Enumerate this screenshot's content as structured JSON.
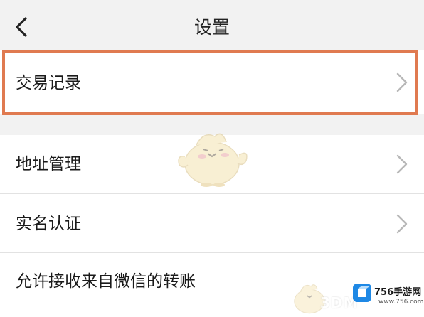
{
  "header": {
    "title": "设置",
    "back_icon": "chevron-left-icon"
  },
  "settings_items": [
    {
      "label": "交易记录",
      "icon": "chevron-right-icon"
    },
    {
      "label": "地址管理",
      "icon": "chevron-right-icon"
    },
    {
      "label": "实名认证",
      "icon": "chevron-right-icon"
    },
    {
      "label": "允许接收来自微信的转账"
    }
  ],
  "highlight_color": "#e07a50",
  "watermark": {
    "text": "3DM",
    "brand_name": "756手游网",
    "brand_url": "www.756.com",
    "brand_color": "#1e88e5"
  }
}
